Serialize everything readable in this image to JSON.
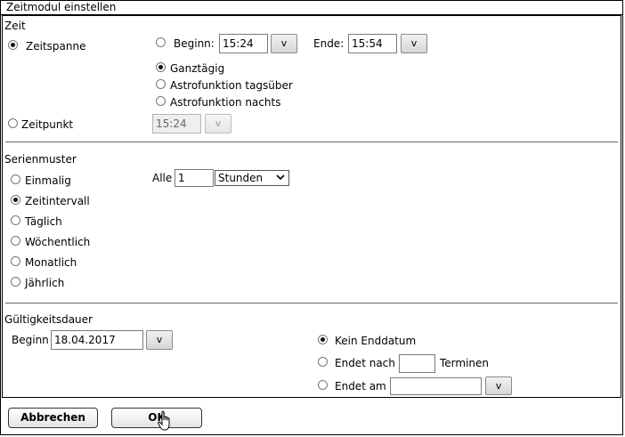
{
  "window": {
    "title": "Zeitmodul einstellen"
  },
  "zeit": {
    "heading": "Zeit",
    "zeitspanne_label": "Zeitspanne",
    "beginn_label": "Beginn:",
    "beginn_value": "15:24",
    "ende_label": "Ende:",
    "ende_value": "15:54",
    "ganztaegig_label": "Ganztägig",
    "astro_tag_label": "Astrofunktion tagsüber",
    "astro_nacht_label": "Astrofunktion nachts",
    "zeitpunkt_label": "Zeitpunkt",
    "zeitpunkt_value": "15:24",
    "picker_label": "v"
  },
  "serien": {
    "heading": "Serienmuster",
    "options": [
      "Einmalig",
      "Zeitintervall",
      "Täglich",
      "Wöchentlich",
      "Monatlich",
      "Jährlich"
    ],
    "selected": "Zeitintervall",
    "alle_label": "Alle",
    "alle_value": "1",
    "unit_selected": "Stunden"
  },
  "gueltigkeit": {
    "heading": "Gültigkeitsdauer",
    "beginn_label": "Beginn",
    "beginn_value": "18.04.2017",
    "kein_enddatum_label": "Kein Enddatum",
    "endet_nach_label": "Endet nach",
    "endet_nach_value": "",
    "terminen_label": "Terminen",
    "endet_am_label": "Endet am",
    "endet_am_value": ""
  },
  "footer": {
    "cancel_label": "Abbrechen",
    "ok_label": "OK"
  }
}
